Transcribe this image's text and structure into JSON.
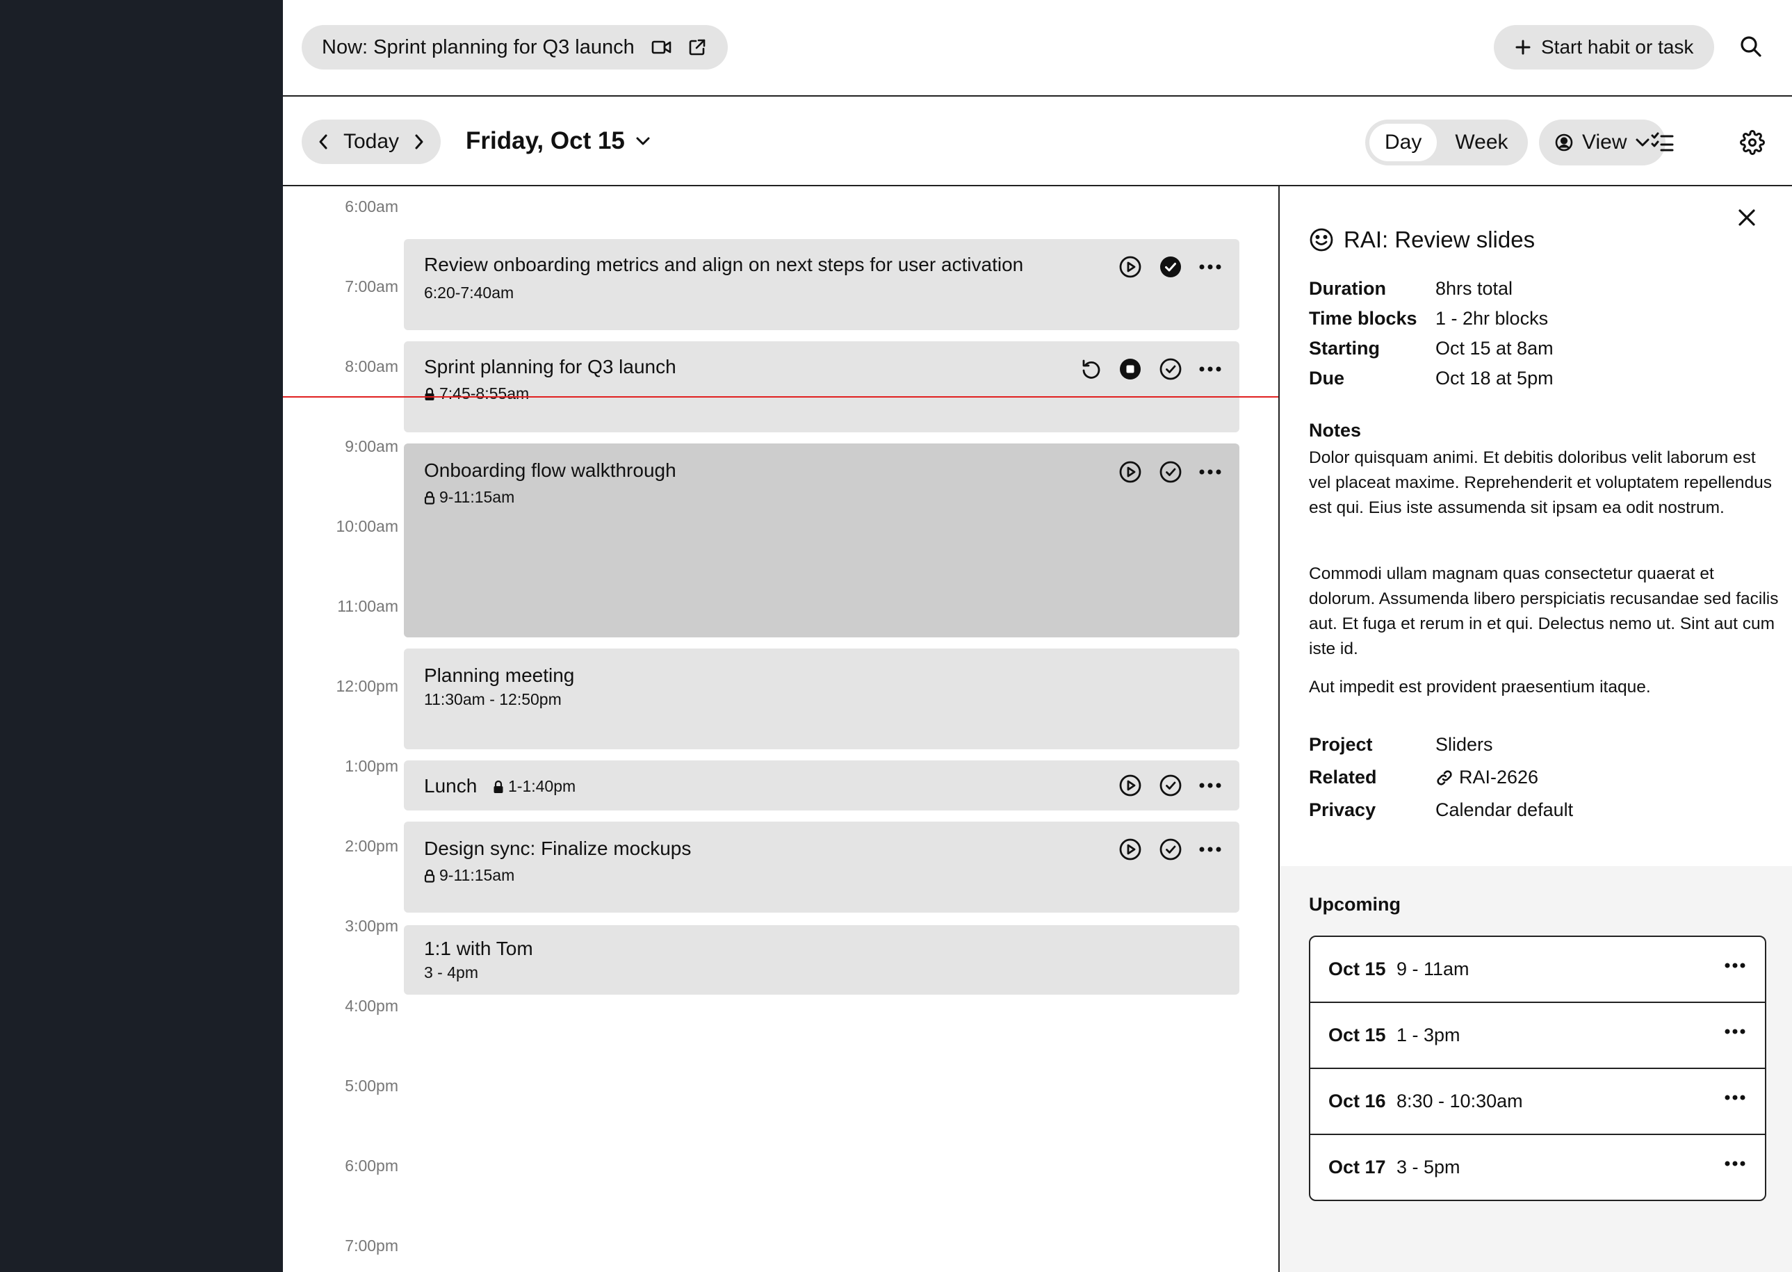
{
  "topbar": {
    "now_label": "Now: Sprint planning for Q3 launch",
    "start_label": "Start habit or task"
  },
  "datebar": {
    "today_label": "Today",
    "date_title": "Friday, Oct 15",
    "view_modes": [
      "Day",
      "Week"
    ],
    "active_view_mode": "Day",
    "view_label": "View"
  },
  "calendar": {
    "time_labels": [
      "6:00am",
      "7:00am",
      "8:00am",
      "9:00am",
      "10:00am",
      "11:00am",
      "12:00pm",
      "1:00pm",
      "2:00pm",
      "3:00pm",
      "4:00pm",
      "5:00pm",
      "6:00pm",
      "7:00pm"
    ],
    "events": [
      {
        "title": "Review onboarding metrics and align on next steps for user activation",
        "time": "6:20-7:40am"
      },
      {
        "title": "Sprint planning for Q3 launch",
        "time": "7:45-8:55am"
      },
      {
        "title": "Onboarding flow walkthrough",
        "time": "9-11:15am"
      },
      {
        "title": "Planning meeting",
        "time": "11:30am - 12:50pm"
      },
      {
        "title": "Lunch",
        "time": "1-1:40pm"
      },
      {
        "title": "Design sync: Finalize mockups",
        "time": "9-11:15am"
      },
      {
        "title": "1:1 with Tom",
        "time": "3 - 4pm"
      }
    ]
  },
  "details": {
    "title": "RAI: Review slides",
    "fields": [
      {
        "key": "Duration",
        "value": "8hrs total"
      },
      {
        "key": "Time blocks",
        "value": "1 - 2hr blocks"
      },
      {
        "key": "Starting",
        "value": "Oct 15 at 8am"
      },
      {
        "key": "Due",
        "value": "Oct 18 at 5pm"
      }
    ],
    "notes_label": "Notes",
    "notes": [
      "Dolor quisquam animi. Et debitis doloribus velit laborum est vel placeat maxime. Reprehenderit et voluptatem repellendus est qui. Eius iste assumenda sit ipsam ea odit nostrum.",
      "Commodi ullam magnam quas consectetur quaerat et dolorum. Assumenda libero perspiciatis recusandae sed facilis aut. Et fuga et rerum in et qui. Delectus nemo ut. Sint aut cum iste id.",
      "Aut impedit est provident praesentium itaque."
    ],
    "meta": [
      {
        "key": "Project",
        "value": "Sliders"
      },
      {
        "key": "Related",
        "value": "RAI-2626"
      },
      {
        "key": "Privacy",
        "value": "Calendar default"
      }
    ],
    "upcoming_label": "Upcoming",
    "upcoming": [
      {
        "date": "Oct 15",
        "time": "9 - 11am"
      },
      {
        "date": "Oct 15",
        "time": "1 - 3pm"
      },
      {
        "date": "Oct 16",
        "time": "8:30 - 10:30am"
      },
      {
        "date": "Oct 17",
        "time": "3 - 5pm"
      }
    ]
  },
  "colors": {
    "sidebar": "#1b1f27",
    "pill": "#e4e4e4",
    "event": "#e4e4e4",
    "event_active": "#cdcdcd",
    "now_line": "#e02020"
  }
}
